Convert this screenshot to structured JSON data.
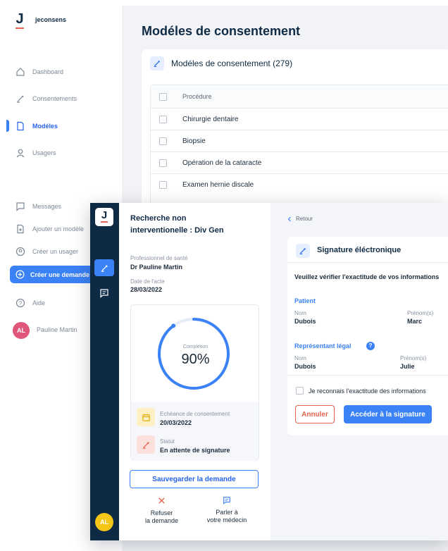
{
  "app": {
    "logo_letter": "J",
    "name": "jeconsens"
  },
  "sidebar": {
    "items": [
      {
        "label": "Dashboard"
      },
      {
        "label": "Consentements"
      },
      {
        "label": "Modéles"
      },
      {
        "label": "Usagers"
      },
      {
        "label": "Messages"
      },
      {
        "label": "Ajouter un modèle"
      },
      {
        "label": "Créer un usager"
      },
      {
        "label": "Créer une demande"
      },
      {
        "label": "Aide"
      }
    ],
    "user": {
      "initials": "AL",
      "name": "Pauline Martin"
    }
  },
  "main": {
    "page_title": "Modéles de consentement",
    "card_title": "Modéles de consentement (279)",
    "table": {
      "header": "Procédure",
      "rows": [
        "Chirurgie dentaire",
        "Biopsie",
        "Opération de la cataracte",
        "Examen hernie discale"
      ]
    }
  },
  "overlay": {
    "logo_letter": "J",
    "avatar_initials": "AL",
    "request": {
      "title_line1": "Recherche non",
      "title_line2": "interventionelle : Div Gen",
      "professional_label": "Professionnel de santé",
      "professional_value": "Dr Pauline Martin",
      "date_label": "Date de l'acte",
      "date_value": "28/03/2022",
      "completion_label": "Complétion",
      "completion_value": "90%",
      "completion_fraction": 0.9,
      "deadline_label": "Echéance de consentement",
      "deadline_value": "20/03/2022",
      "status_label": "Statut",
      "status_value": "En attente de signature",
      "save_button": "Sauvegarder la demande",
      "refuse_line1": "Refuser",
      "refuse_line2": "la demande",
      "talk_line1": "Parler à",
      "talk_line2": "votre médecin"
    },
    "signature": {
      "back_label": "Retour",
      "card_title": "Signature éléctronique",
      "instructions": "Veuillez vérifier l'exactitude de vos informations",
      "patient_heading": "Patient",
      "nom_label": "Nom",
      "prenom_label": "Prénom(s)",
      "patient_nom": "Dubois",
      "patient_prenom": "Marc",
      "rep_heading": "Représentant légal",
      "rep_help": "?",
      "rep_nom": "Dubois",
      "rep_prenom": "Julie",
      "checkbox_label": "Je reconnais l'exactitude des informations",
      "cancel_button": "Annuler",
      "sign_button": "Accéder à la signature"
    }
  },
  "colors": {
    "accent": "#3b82f6",
    "navy": "#0f2a44",
    "danger": "#e0644f",
    "warning": "#f5c518"
  }
}
